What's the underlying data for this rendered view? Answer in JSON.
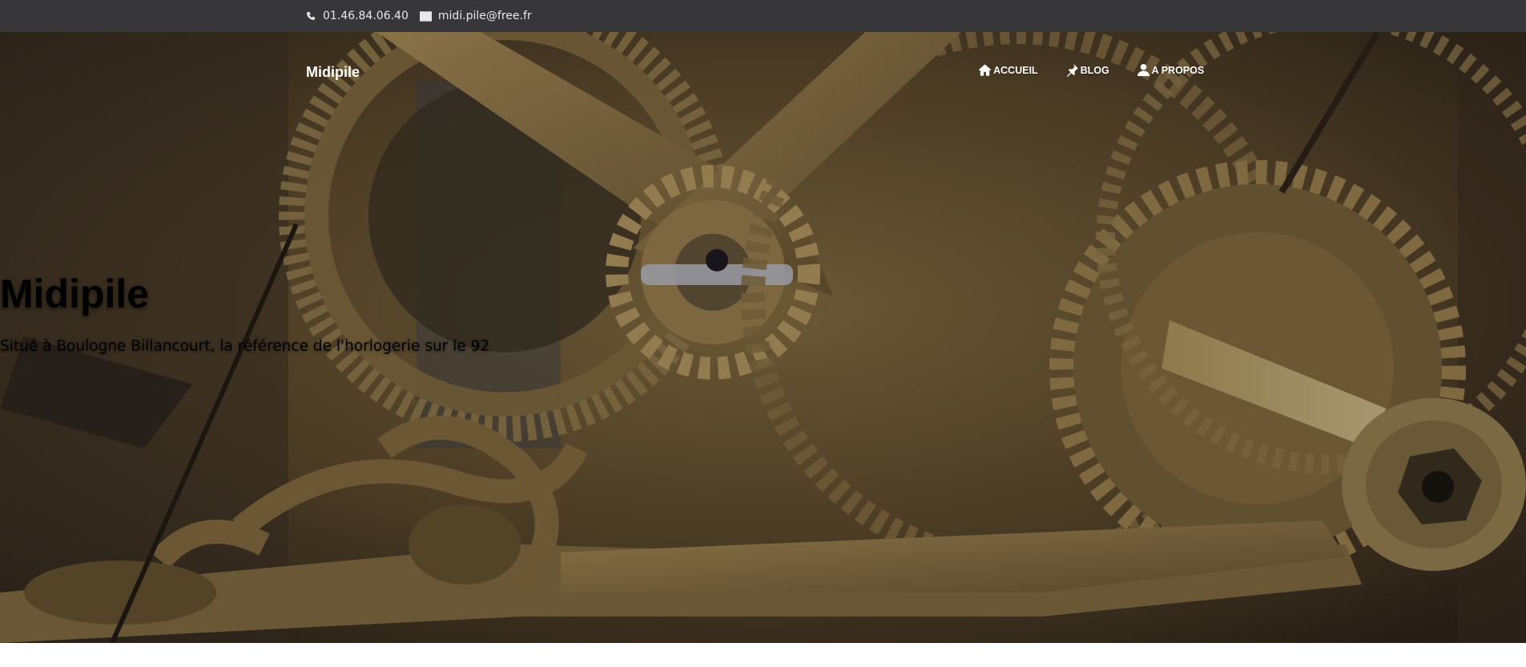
{
  "topbar": {
    "phone": "01.46.84.06.40",
    "phone_icon": "phone-icon",
    "email": "midi.pile@free.fr",
    "email_icon": "envelope-icon"
  },
  "navbar": {
    "brand": "Midipile",
    "items": [
      {
        "label": "ACCUEIL",
        "icon": "home-icon"
      },
      {
        "label": "BLOG",
        "icon": "pin-icon"
      },
      {
        "label": "A PROPOS",
        "icon": "user-icon"
      }
    ]
  },
  "hero": {
    "title": "Midipile",
    "subtitle": "Situé à Boulogne Billancourt, la référence de l'horlogerie sur le 92",
    "background_image": "clock-gears-photo"
  },
  "colors": {
    "topbar_bg": "#37373a",
    "text": "#ffffff",
    "brass": "#a88a52"
  }
}
